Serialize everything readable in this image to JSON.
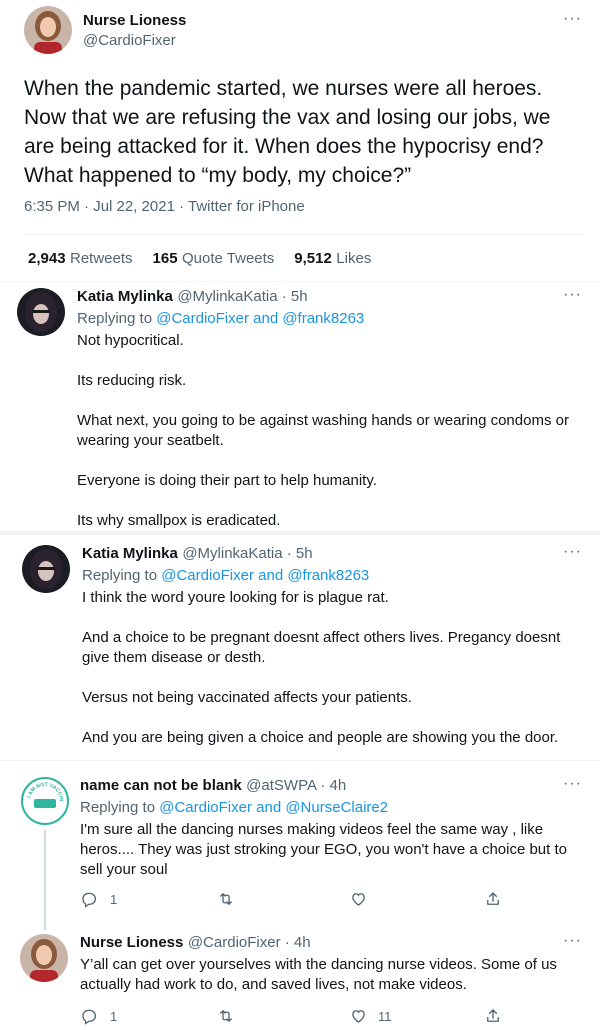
{
  "main_tweet": {
    "display_name": "Nurse Lioness",
    "handle": "@CardioFixer",
    "text": "When the pandemic started, we nurses were all heroes. Now that we are refusing the vax and losing our jobs, we are being attacked for it. When does the hypocrisy end? What happened to “my body, my choice?”",
    "timestamp": "6:35 PM · Jul 22, 2021 · Twitter for iPhone",
    "stats": {
      "retweets_count": "2,943",
      "retweets_label": "Retweets",
      "quotes_count": "165",
      "quotes_label": "Quote Tweets",
      "likes_count": "9,512",
      "likes_label": "Likes"
    },
    "more": "···"
  },
  "replies": [
    {
      "display_name": "Katia Mylinka",
      "handle_time": "@MylinkaKatia · 5h",
      "replying_prefix": "Replying to",
      "replying_to": "@CardioFixer and @frank8263",
      "paragraphs": [
        "Not hypocritical.",
        "Its reducing risk.",
        "What next, you going to be against washing hands or wearing condoms or wearing your seatbelt.",
        "Everyone is doing their part to help humanity.",
        "Its why smallpox is eradicated."
      ],
      "more": "···"
    },
    {
      "display_name": "Katia Mylinka",
      "handle_time": "@MylinkaKatia · 5h",
      "replying_prefix": "Replying to",
      "replying_to": "@CardioFixer and @frank8263",
      "paragraphs": [
        "I think the word youre looking for is plague rat.",
        "And a choice to be pregnant doesnt affect others lives. Pregancy doesnt give them disease or desth.",
        "Versus not being vaccinated affects your patients.",
        "And you are being given a choice and people are showing you the door."
      ],
      "more": "···"
    },
    {
      "display_name": "name can not be blank",
      "handle_time": "@atSWPA · 4h",
      "replying_prefix": "Replying to",
      "replying_to": "@CardioFixer and @NurseClaire2",
      "paragraphs": [
        "I'm sure all the dancing nurses making videos feel the same way , like heros.... They was just stroking your EGO, you won't have a choice but to sell your soul"
      ],
      "avatar_text": "I AM NOT VACCINATED",
      "actions": {
        "reply_count": "1",
        "retweet_count": "",
        "like_count": ""
      },
      "more": "···"
    },
    {
      "display_name": "Nurse Lioness",
      "handle_time": "@CardioFixer · 4h",
      "paragraphs": [
        "Y’all can get over yourselves with the dancing nurse videos. Some of us actually had work to do, and saved lives, not make videos."
      ],
      "actions": {
        "reply_count": "1",
        "retweet_count": "",
        "like_count": "11"
      },
      "more": "···"
    }
  ],
  "colors": {
    "link": "#1b95e0",
    "secondary_text": "#536471",
    "primary_text": "#0f1419",
    "divider": "#eff3f4"
  },
  "icons": [
    "reply-icon",
    "retweet-icon",
    "like-icon",
    "share-icon",
    "more-icon"
  ]
}
